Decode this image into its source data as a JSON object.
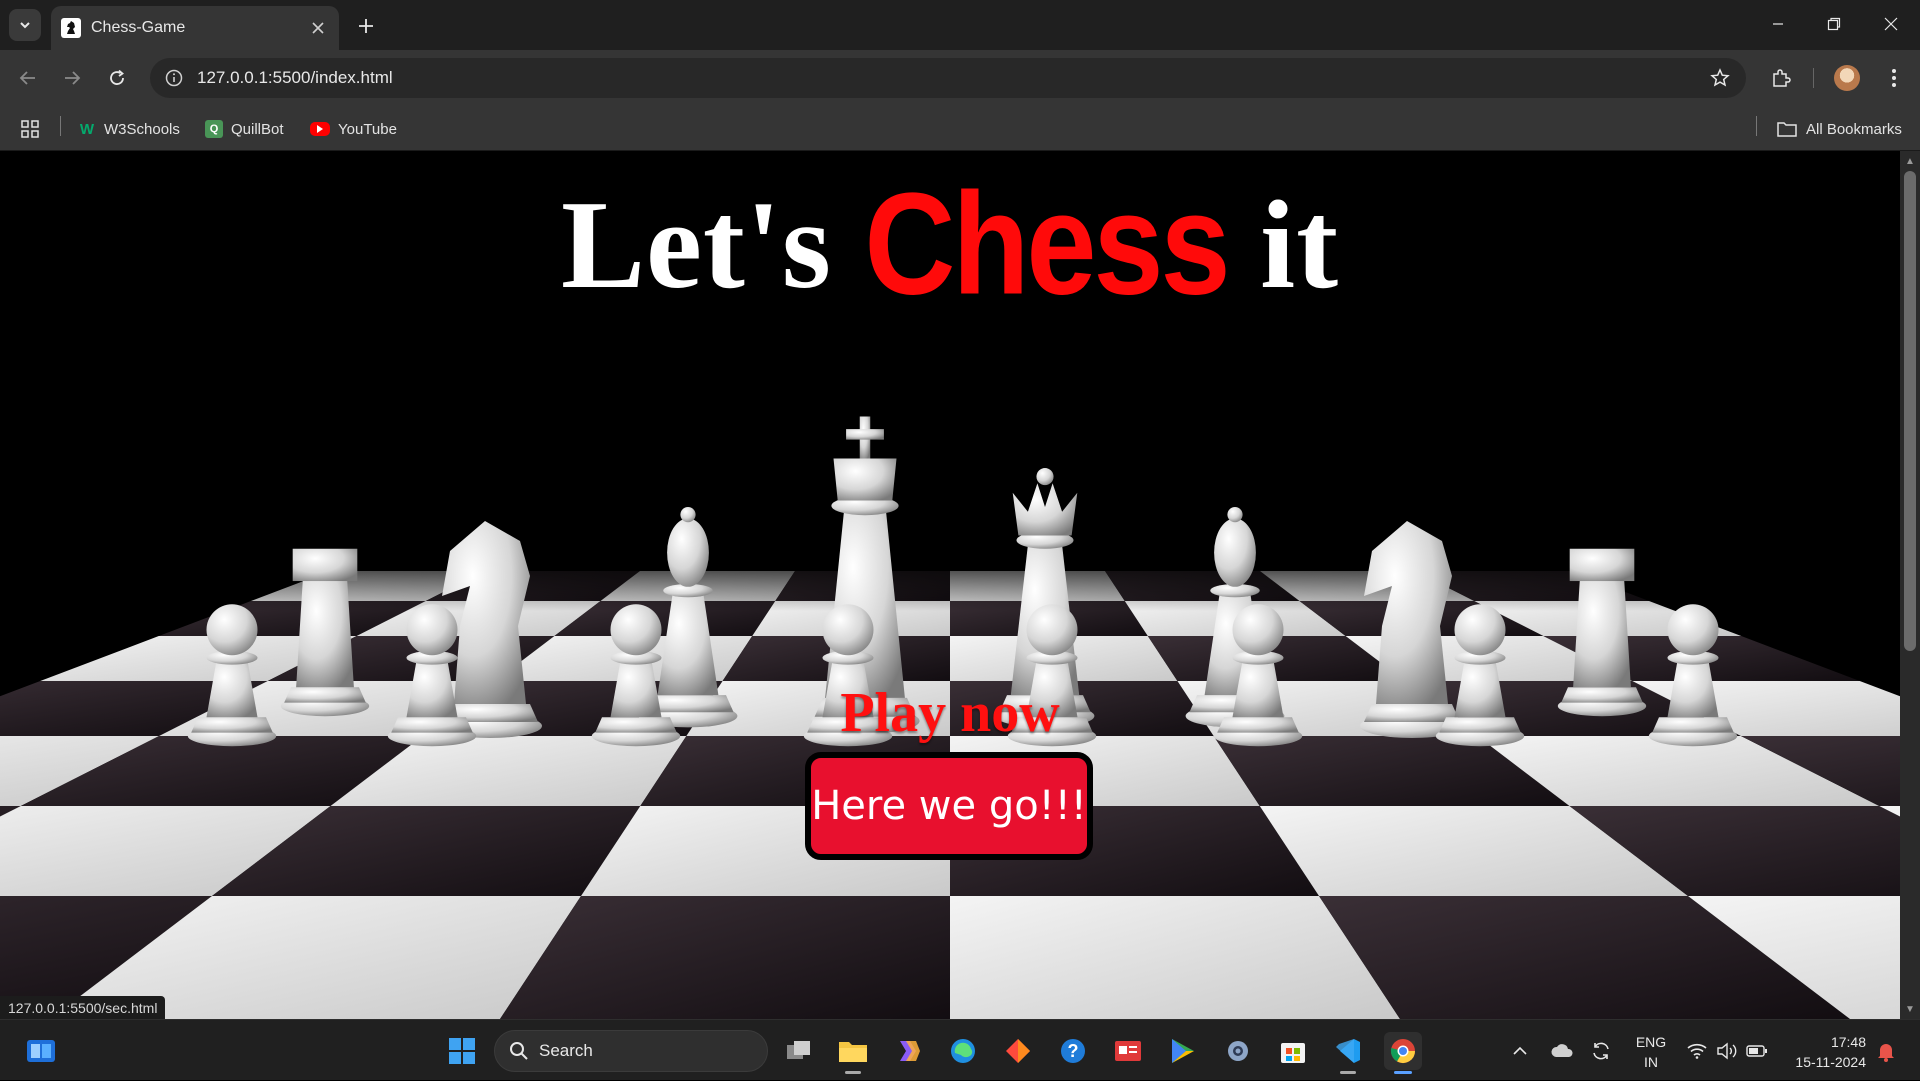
{
  "browser": {
    "tab_title": "Chess-Game",
    "url": "127.0.0.1:5500/index.html",
    "bookmarks": [
      {
        "label": "W3Schools",
        "icon": "w3schools-icon",
        "color": "#04aa6d"
      },
      {
        "label": "QuillBot",
        "icon": "quillbot-icon",
        "color": "#499557"
      },
      {
        "label": "YouTube",
        "icon": "youtube-icon",
        "color": "#ff0000"
      }
    ],
    "all_bookmarks_label": "All Bookmarks",
    "status_url": "127.0.0.1:5500/sec.html"
  },
  "page": {
    "headline_prefix": "Let's ",
    "headline_accent": "Chess",
    "headline_suffix": " it",
    "play_label": "Play now",
    "button_label": "Here we go!!!",
    "colors": {
      "accent": "#ff0a0a",
      "button_bg": "#e8102e",
      "background": "#000000"
    }
  },
  "taskbar": {
    "search_placeholder": "Search",
    "lang_line1": "ENG",
    "lang_line2": "IN",
    "time": "17:48",
    "date": "15-11-2024"
  }
}
